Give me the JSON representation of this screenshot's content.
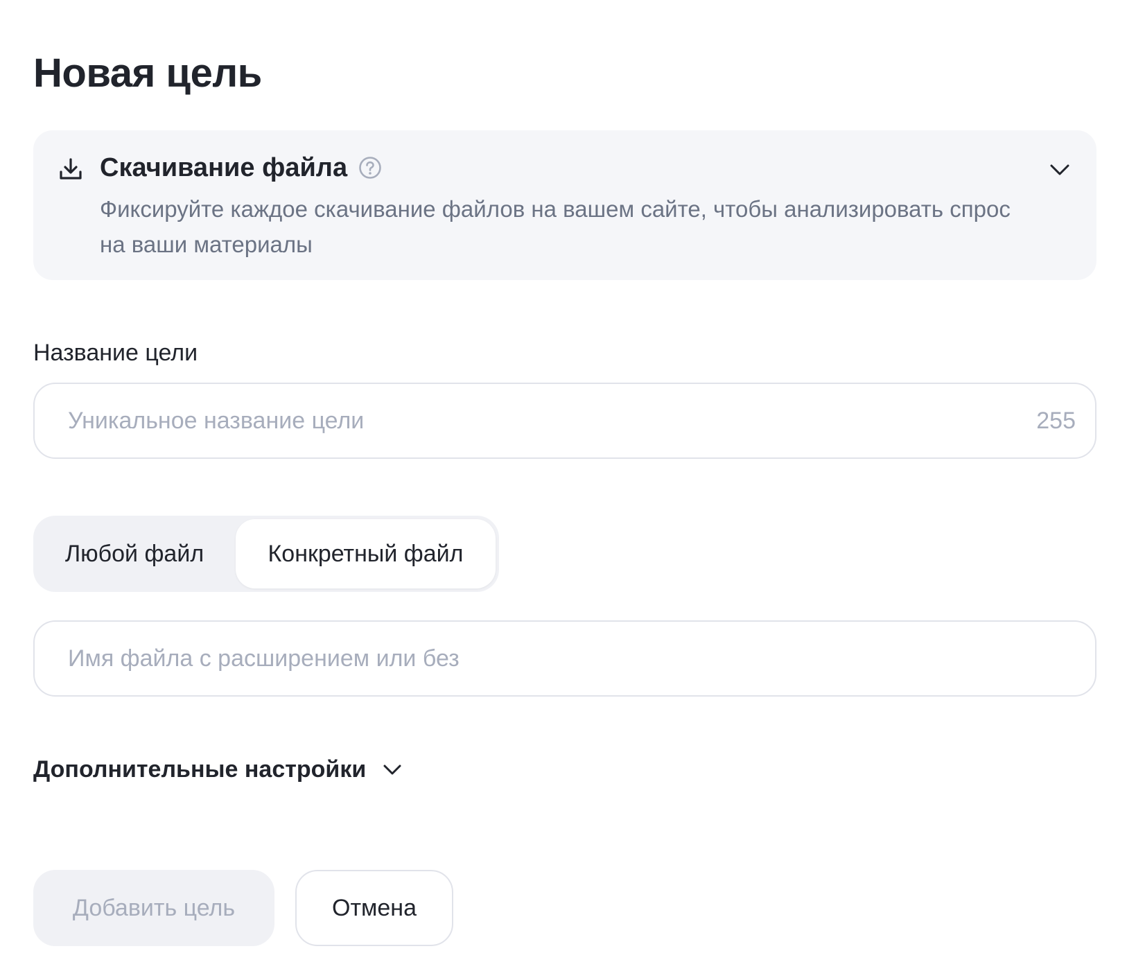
{
  "page": {
    "title": "Новая цель"
  },
  "goal_type": {
    "title": "Скачивание файла",
    "description": "Фиксируйте каждое скачивание файлов на вашем сайте, чтобы анализировать спрос на ваши материалы",
    "icon": "download-icon",
    "help_icon": "question-circle-icon",
    "expand_icon": "chevron-down-icon"
  },
  "goal_name": {
    "label": "Название цели",
    "placeholder": "Уникальное название цели",
    "value": "",
    "counter": "255"
  },
  "file_mode": {
    "options": [
      "Любой файл",
      "Конкретный файл"
    ],
    "selected": "Конкретный файл"
  },
  "file_name": {
    "placeholder": "Имя файла с расширением или без",
    "value": ""
  },
  "advanced": {
    "label": "Дополнительные настройки",
    "icon": "chevron-down-icon"
  },
  "actions": {
    "add_label": "Добавить цель",
    "cancel_label": "Отмена"
  },
  "colors": {
    "text": "#21242c",
    "muted": "#6b7384",
    "placeholder": "#a7adbc",
    "card_bg": "#f5f6f9",
    "border": "#e1e3ea",
    "segment_bg": "#f0f1f5"
  }
}
